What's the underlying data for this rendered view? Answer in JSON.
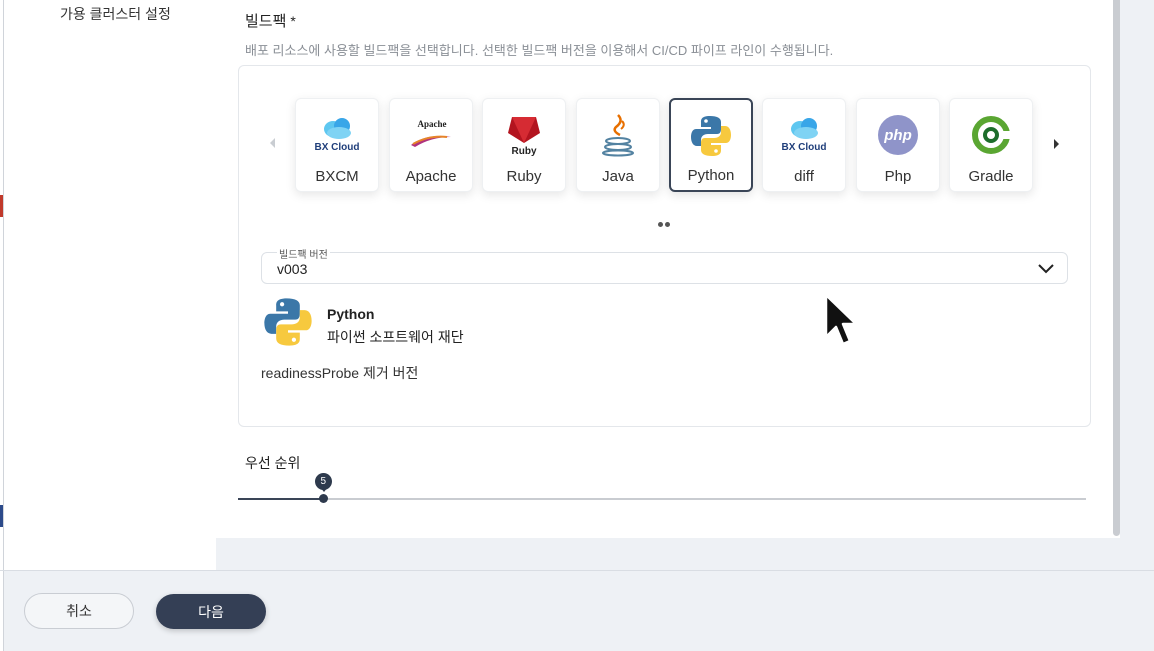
{
  "sidebar": {
    "item_label": "가용 클러스터 설정"
  },
  "buildpack": {
    "title": "빌드팩",
    "required_mark": "*",
    "description": "배포 리소스에 사용할 빌드팩을 선택합니다. 선택한 빌드팩 버전을 이용해서 CI/CD 파이프 라인이 수행됩니다.",
    "cards": [
      {
        "label": "BXCM",
        "icon": "bxcloud-icon",
        "logo_text": "BX Cloud"
      },
      {
        "label": "Apache",
        "icon": "apache-icon",
        "logo_text": "Apache"
      },
      {
        "label": "Ruby",
        "icon": "ruby-icon",
        "logo_text": "Ruby"
      },
      {
        "label": "Java",
        "icon": "java-icon"
      },
      {
        "label": "Python",
        "icon": "python-icon",
        "selected": true
      },
      {
        "label": "diff",
        "icon": "bxcloud-icon",
        "logo_text": "BX Cloud"
      },
      {
        "label": "Php",
        "icon": "php-icon",
        "logo_text": "php"
      },
      {
        "label": "Gradle",
        "icon": "gradle-icon"
      }
    ],
    "version_field": {
      "label": "빌드팩 버전",
      "value": "v003"
    },
    "detail": {
      "name": "Python",
      "vendor": "파이썬 소프트웨어 재단",
      "description": "readinessProbe 제거 버전"
    }
  },
  "priority": {
    "label": "우선 순위",
    "value": 5,
    "min": 0,
    "max": 50
  },
  "footer": {
    "cancel_label": "취소",
    "next_label": "다음"
  },
  "colors": {
    "accent": "#343f55",
    "track": "#c9ccd1"
  }
}
